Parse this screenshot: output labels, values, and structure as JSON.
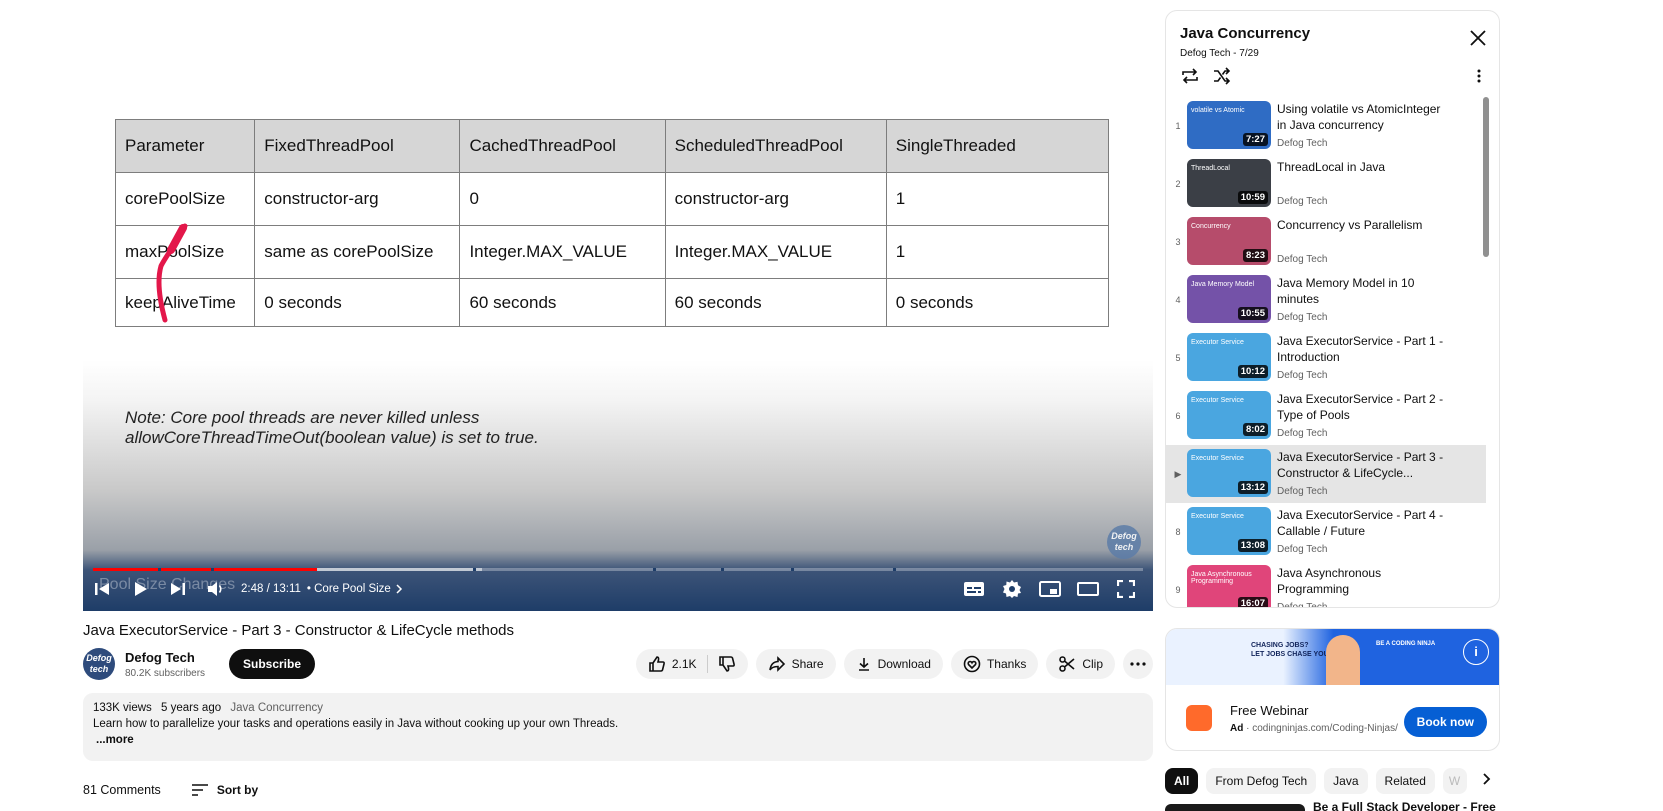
{
  "player": {
    "slide_table": [
      [
        "Parameter",
        "FixedThreadPool",
        "CachedThreadPool",
        "ScheduledThreadPool",
        "SingleThreaded"
      ],
      [
        "corePoolSize",
        "constructor-arg",
        "0",
        "constructor-arg",
        "1"
      ],
      [
        "maxPoolSize",
        "same as corePoolSize",
        "Integer.MAX_VALUE",
        "Integer.MAX_VALUE",
        "1"
      ],
      [
        "keepAliveTime",
        "0 seconds",
        "60 seconds",
        "60 seconds",
        "0 seconds"
      ]
    ],
    "note_line1": "Note: Core pool threads are never killed unless",
    "note_line2": "allowCoreThreadTimeOut(boolean value) is set to true.",
    "watermark": "Defog tech",
    "chapter_overlay": "Pool Size Changes",
    "time": "2:48 / 13:11",
    "chapter": "• Core Pool Size",
    "progress_played": 0.213,
    "progress_loaded": 0.37
  },
  "video": {
    "title": "Java ExecutorService - Part 3 - Constructor & LifeCycle methods",
    "channel": "Defog Tech",
    "subscribers": "80.2K subscribers",
    "subscribe_label": "Subscribe",
    "avatar_text": "Defog tech",
    "likes": "2.1K",
    "share": "Share",
    "download": "Download",
    "thanks": "Thanks",
    "clip": "Clip"
  },
  "description": {
    "views": "133K views",
    "age": "5 years ago",
    "playlist": "Java Concurrency",
    "text": "Learn how to parallelize your tasks and operations easily in Java without cooking up your own Threads.",
    "more": "...more"
  },
  "comments": {
    "count": "81 Comments",
    "sort": "Sort by"
  },
  "playlist": {
    "title": "Java Concurrency",
    "subtitle": "Defog Tech - 7/29",
    "items": [
      {
        "index": "1",
        "title": "Using volatile vs AtomicInteger in Java concurrency",
        "channel": "Defog Tech",
        "duration": "7:27",
        "color": "#2f6cc4",
        "thumb": "volatile vs Atomic"
      },
      {
        "index": "2",
        "title": "ThreadLocal in Java",
        "channel": "Defog Tech",
        "duration": "10:59",
        "color": "#3b3f46",
        "thumb": "ThreadLocal"
      },
      {
        "index": "3",
        "title": "Concurrency vs Parallelism",
        "channel": "Defog Tech",
        "duration": "8:23",
        "color": "#b64c6b",
        "thumb": "Concurrency"
      },
      {
        "index": "4",
        "title": "Java Memory Model in 10 minutes",
        "channel": "Defog Tech",
        "duration": "10:55",
        "color": "#7452a8",
        "thumb": "Java Memory Model"
      },
      {
        "index": "5",
        "title": "Java ExecutorService - Part 1 - Introduction",
        "channel": "Defog Tech",
        "duration": "10:12",
        "color": "#4aa6e0",
        "thumb": "Executor Service"
      },
      {
        "index": "6",
        "title": "Java ExecutorService - Part 2 - Type of Pools",
        "channel": "Defog Tech",
        "duration": "8:02",
        "color": "#4aa6e0",
        "thumb": "Executor Service"
      },
      {
        "index": "▶",
        "title": "Java ExecutorService - Part 3 - Constructor & LifeCycle...",
        "channel": "Defog Tech",
        "duration": "13:12",
        "color": "#4aa6e0",
        "thumb": "Executor Service"
      },
      {
        "index": "8",
        "title": "Java ExecutorService - Part 4 - Callable / Future",
        "channel": "Defog Tech",
        "duration": "13:08",
        "color": "#4aa6e0",
        "thumb": "Executor Service"
      },
      {
        "index": "9",
        "title": "Java Asynchronous Programming",
        "channel": "Defog Tech",
        "duration": "16:07",
        "color": "#e0457a",
        "thumb": "Java Asynchronous Programming"
      }
    ]
  },
  "ad": {
    "banner_line1": "CHASING JOBS?",
    "banner_line2": "LET JOBS CHASE YOU.",
    "banner_right": "BE A CODING NINJA",
    "title": "Free Webinar",
    "ad_label": "Ad",
    "url": "· codingninjas.com/Coding-Ninjas/",
    "cta": "Book now"
  },
  "chips": [
    "All",
    "From Defog Tech",
    "Java",
    "Related",
    "W"
  ],
  "related_title": "Be a Full Stack Developer - Free"
}
